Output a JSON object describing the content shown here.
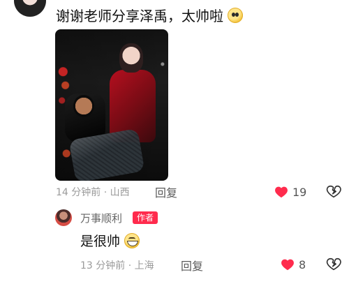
{
  "colors": {
    "heart_red": "#ff2b4d",
    "author_tag_bg": "#ff2b4d",
    "meta_gray": "#9a9a9a"
  },
  "comment": {
    "text": "谢谢老师分享泽禹，太帅啦",
    "emoji": "pleading-face",
    "time_location": "14 分钟前 · 山西",
    "reply_label": "回复",
    "likes": "19"
  },
  "reply": {
    "username": "万事顺利",
    "author_tag": "作者",
    "text": "是很帅",
    "emoji": "grinning-face",
    "time_location": "13 分钟前 · 上海",
    "reply_label": "回复",
    "likes": "8"
  }
}
